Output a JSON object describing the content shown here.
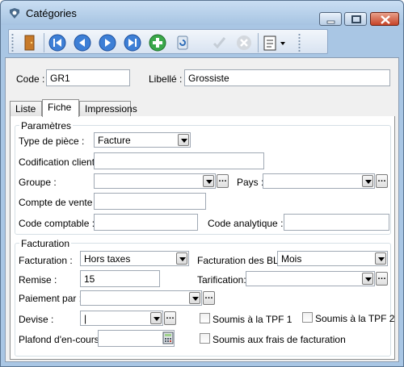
{
  "window": {
    "title": "Catégories"
  },
  "header": {
    "code_label": "Code :",
    "code_value": "GR1",
    "libelle_label": "Libellé :",
    "libelle_value": "Grossiste"
  },
  "tabs": [
    {
      "label": "Liste"
    },
    {
      "label": "Fiche"
    },
    {
      "label": "Impressions"
    }
  ],
  "parametres": {
    "title": "Paramètres",
    "type_piece_label": "Type de pièce :",
    "type_piece_value": "Facture",
    "codification_label": "Codification client :",
    "codification_value": "",
    "groupe_label": "Groupe :",
    "groupe_value": "",
    "pays_label": "Pays :",
    "pays_value": "",
    "compte_vente_label": "Compte de vente :",
    "compte_vente_value": "",
    "code_comptable_label": "Code comptable :",
    "code_comptable_value": "",
    "code_analytique_label": "Code analytique :",
    "code_analytique_value": ""
  },
  "facturation": {
    "title": "Facturation",
    "facturation_label": "Facturation :",
    "facturation_value": "Hors taxes",
    "facturation_bl_label": "Facturation des BL :",
    "facturation_bl_value": "Mois",
    "remise_label": "Remise :",
    "remise_value": "15",
    "tarification_label": "Tarification:",
    "tarification_value": "",
    "paiement_label": "Paiement par :",
    "paiement_value": "",
    "devise_label": "Devise :",
    "devise_value": "|",
    "tpf1_label": "Soumis à la TPF 1",
    "tpf1_checked": false,
    "tpf2_label": "Soumis à la TPF 2",
    "tpf2_checked": false,
    "plafond_label": "Plafond d'en-cours:",
    "plafond_value": "",
    "frais_label": "Soumis aux frais de facturation",
    "frais_checked": false
  },
  "toolbar": {
    "icons": [
      "door-exit-icon",
      "first-record-icon",
      "previous-record-icon",
      "next-record-icon",
      "last-record-icon",
      "add-record-icon",
      "refresh-record-icon",
      "validate-icon",
      "cancel-icon",
      "report-menu-icon"
    ]
  }
}
